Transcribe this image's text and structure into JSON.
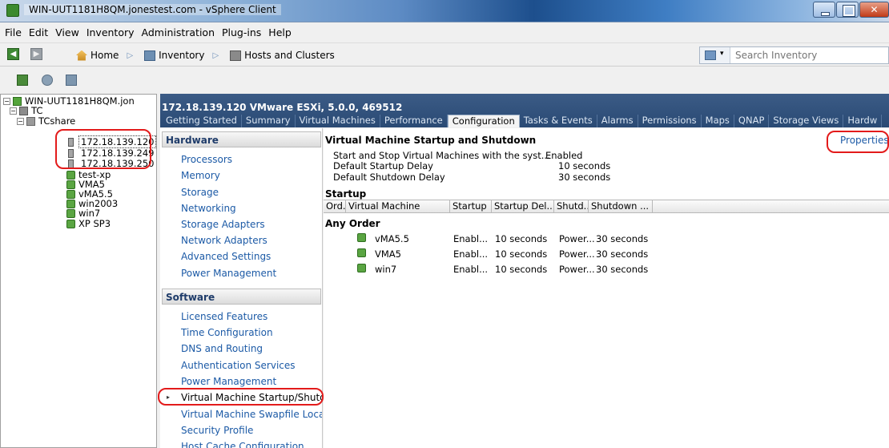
{
  "window": {
    "title": "WIN-UUT1181H8QM.jonestest.com - vSphere Client"
  },
  "menu": [
    "File",
    "Edit",
    "View",
    "Inventory",
    "Administration",
    "Plug-ins",
    "Help"
  ],
  "nav": {
    "home": "Home",
    "inventory": "Inventory",
    "hosts_clusters": "Hosts and Clusters",
    "search_placeholder": "Search Inventory"
  },
  "tree": {
    "vcenter": "WIN-UUT1181H8QM.jon",
    "datacenter": "TC",
    "cluster": "TCshare",
    "hosts": [
      "172.18.139.120",
      "172.18.139.249",
      "172.18.139.250"
    ],
    "vms": [
      "test-xp",
      "VMA5",
      "vMA5.5",
      "win2003",
      "win7",
      "XP SP3"
    ]
  },
  "host_header": "172.18.139.120 VMware ESXi, 5.0.0, 469512",
  "tabs": [
    "Getting Started",
    "Summary",
    "Virtual Machines",
    "Performance",
    "Configuration",
    "Tasks & Events",
    "Alarms",
    "Permissions",
    "Maps",
    "QNAP",
    "Storage Views",
    "Hardw"
  ],
  "hardware": {
    "title": "Hardware",
    "items": [
      "Processors",
      "Memory",
      "Storage",
      "Networking",
      "Storage Adapters",
      "Network Adapters",
      "Advanced Settings",
      "Power Management"
    ]
  },
  "software": {
    "title": "Software",
    "items": [
      "Licensed Features",
      "Time Configuration",
      "DNS and Routing",
      "Authentication Services",
      "Power Management",
      "Virtual Machine Startup/Shutd",
      "Virtual Machine Swapfile Locati",
      "Security Profile",
      "Host Cache Configuration"
    ]
  },
  "panel": {
    "title": "Virtual Machine Startup and Shutdown",
    "properties": "Properties",
    "settings": [
      {
        "label": "Start and Stop Virtual Machines with the syst...",
        "value": "Enabled"
      },
      {
        "label": "Default Startup Delay",
        "value": "10 seconds"
      },
      {
        "label": "Default Shutdown Delay",
        "value": "30 seconds"
      }
    ],
    "startup_label": "Startup",
    "columns": [
      "Ord...",
      "Virtual Machine",
      "Startup",
      "Startup Del...",
      "Shutd...",
      "Shutdown ..."
    ],
    "group": "Any Order",
    "rows": [
      {
        "vm": "vMA5.5",
        "startup": "Enabl...",
        "startup_delay": "10 seconds",
        "shutdown": "Power...",
        "shutdown_delay": "30 seconds"
      },
      {
        "vm": "VMA5",
        "startup": "Enabl...",
        "startup_delay": "10 seconds",
        "shutdown": "Power...",
        "shutdown_delay": "30 seconds"
      },
      {
        "vm": "win7",
        "startup": "Enabl...",
        "startup_delay": "10 seconds",
        "shutdown": "Power...",
        "shutdown_delay": "30 seconds"
      }
    ]
  },
  "colors": {
    "annotation": "#e31b1b",
    "link": "#1c5aa6",
    "header_bg": "#2f4f7a"
  }
}
